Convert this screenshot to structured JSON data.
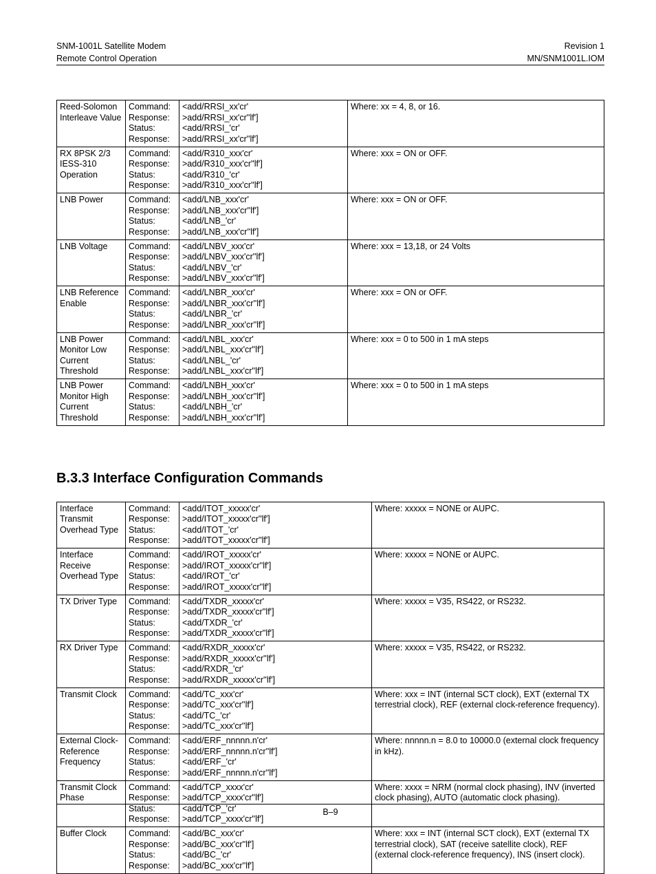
{
  "header": {
    "left1": "SNM-1001L Satellite Modem",
    "right1": "Revision 1",
    "left2": "Remote Control Operation",
    "right2": "MN/SNM1001L.IOM"
  },
  "labels": {
    "crsr": "Command:\nResponse:\nStatus:\nResponse:"
  },
  "table1": [
    {
      "p": "Reed-Solomon Interleave Value",
      "s": "<add/RRSI_xx'cr'\n>add/RRSI_xx'cr''lf']\n<add/RRSI_'cr'\n>add/RRSI_xx'cr''lf']",
      "w": "Where: xx = 4, 8, or 16."
    },
    {
      "p": "RX 8PSK 2/3 IESS-310 Operation",
      "s": "<add/R310_xxx'cr'\n>add/R310_xxx'cr''lf']\n<add/R310_'cr'\n>add/R310_xxx'cr''lf']",
      "w": "Where: xxx = ON or OFF."
    },
    {
      "p": "LNB Power",
      "s": "<add/LNB_xxx'cr'\n>add/LNB_xxx'cr''lf']\n<add/LNB_'cr'\n>add/LNB_xxx'cr''lf']",
      "w": "Where: xxx = ON or OFF."
    },
    {
      "p": "LNB Voltage",
      "s": "<add/LNBV_xxx'cr'\n>add/LNBV_xxx'cr''lf']\n<add/LNBV_'cr'\n>add/LNBV_xxx'cr''lf']",
      "w": "Where: xxx = 13,18, or 24 Volts"
    },
    {
      "p": "LNB Reference Enable",
      "s": "<add/LNBR_xxx'cr'\n>add/LNBR_xxx'cr''lf']\n<add/LNBR_'cr'\n>add/LNBR_xxx'cr''lf']",
      "w": "Where: xxx = ON or OFF."
    },
    {
      "p": "LNB Power Monitor Low Current Threshold",
      "s": "<add/LNBL_xxx'cr'\n>add/LNBL_xxx'cr''lf']\n<add/LNBL_'cr'\n>add/LNBL_xxx'cr''lf']",
      "w": "Where: xxx =  0 to 500 in 1 mA steps"
    },
    {
      "p": "LNB Power Monitor High Current Threshold",
      "s": "<add/LNBH_xxx'cr'\n>add/LNBH_xxx'cr''lf']\n<add/LNBH_'cr'\n>add/LNBH_xxx'cr''lf']\n ",
      "w": "Where: xxx =  0 to 500 in 1 mA steps"
    }
  ],
  "section_heading": "B.3.3 Interface Configuration Commands",
  "table2": [
    {
      "p": "Interface Transmit Overhead Type",
      "s": "<add/ITOT_xxxxx'cr'\n>add/ITOT_xxxxx'cr''lf']\n<add/ITOT_'cr'\n>add/ITOT_xxxxx'cr''lf']",
      "w": "Where: xxxxx = NONE or AUPC."
    },
    {
      "p": "Interface Receive Overhead Type",
      "s": "<add/IROT_xxxxx'cr'\n>add/IROT_xxxxx'cr''lf']\n<add/IROT_'cr'\n>add/IROT_xxxxx'cr''lf']",
      "w": "Where: xxxxx = NONE or AUPC."
    },
    {
      "p": "TX Driver Type",
      "s": "<add/TXDR_xxxxx'cr'\n>add/TXDR_xxxxx'cr''lf']\n<add/TXDR_'cr'\n>add/TXDR_xxxxx'cr''lf']",
      "w": "Where: xxxxx =  V35, RS422, or RS232."
    },
    {
      "p": "RX Driver Type",
      "s": "<add/RXDR_xxxxx'cr'\n>add/RXDR_xxxxx'cr''lf']\n<add/RXDR_'cr'\n>add/RXDR_xxxxx'cr''lf']",
      "w": "Where: xxxxx = V35, RS422, or RS232."
    },
    {
      "p": "Transmit Clock",
      "s": "<add/TC_xxx'cr'\n>add/TC_xxx'cr''lf']\n<add/TC_'cr'\n>add/TC_xxx'cr''lf']",
      "w": "Where: xxx = INT (internal SCT clock), EXT (external TX terrestrial clock), REF (external clock-reference frequency)."
    },
    {
      "p": "External Clock-Reference Frequency",
      "s": "<add/ERF_nnnnn.n'cr'\n>add/ERF_nnnnn.n'cr''lf']\n<add/ERF_'cr'\n>add/ERF_nnnnn.n'cr''lf']\n ",
      "w": "Where: nnnnn.n = 8.0 to 10000.0 (external clock frequency in kHz)."
    },
    {
      "p": "Transmit Clock Phase",
      "s": "<add/TCP_xxxx'cr'\n>add/TCP_xxxx'cr''lf']\n<add/TCP_'cr'\n>add/TCP_xxxx'cr''lf']",
      "w": "Where: xxxx = NRM (normal clock phasing), INV (inverted clock phasing), AUTO (automatic clock phasing)."
    },
    {
      "p": "Buffer Clock",
      "s": "<add/BC_xxx'cr'\n>add/BC_xxx'cr''lf']\n<add/BC_'cr'\n>add/BC_xxx'cr''lf']",
      "w": "Where: xxx = INT (internal SCT clock), EXT (external TX terrestrial clock), SAT (receive satellite clock), REF (external clock-reference frequency), INS (insert clock)."
    }
  ],
  "footer": "B–9",
  "col_widths_t2": {
    "c3": "280px"
  }
}
